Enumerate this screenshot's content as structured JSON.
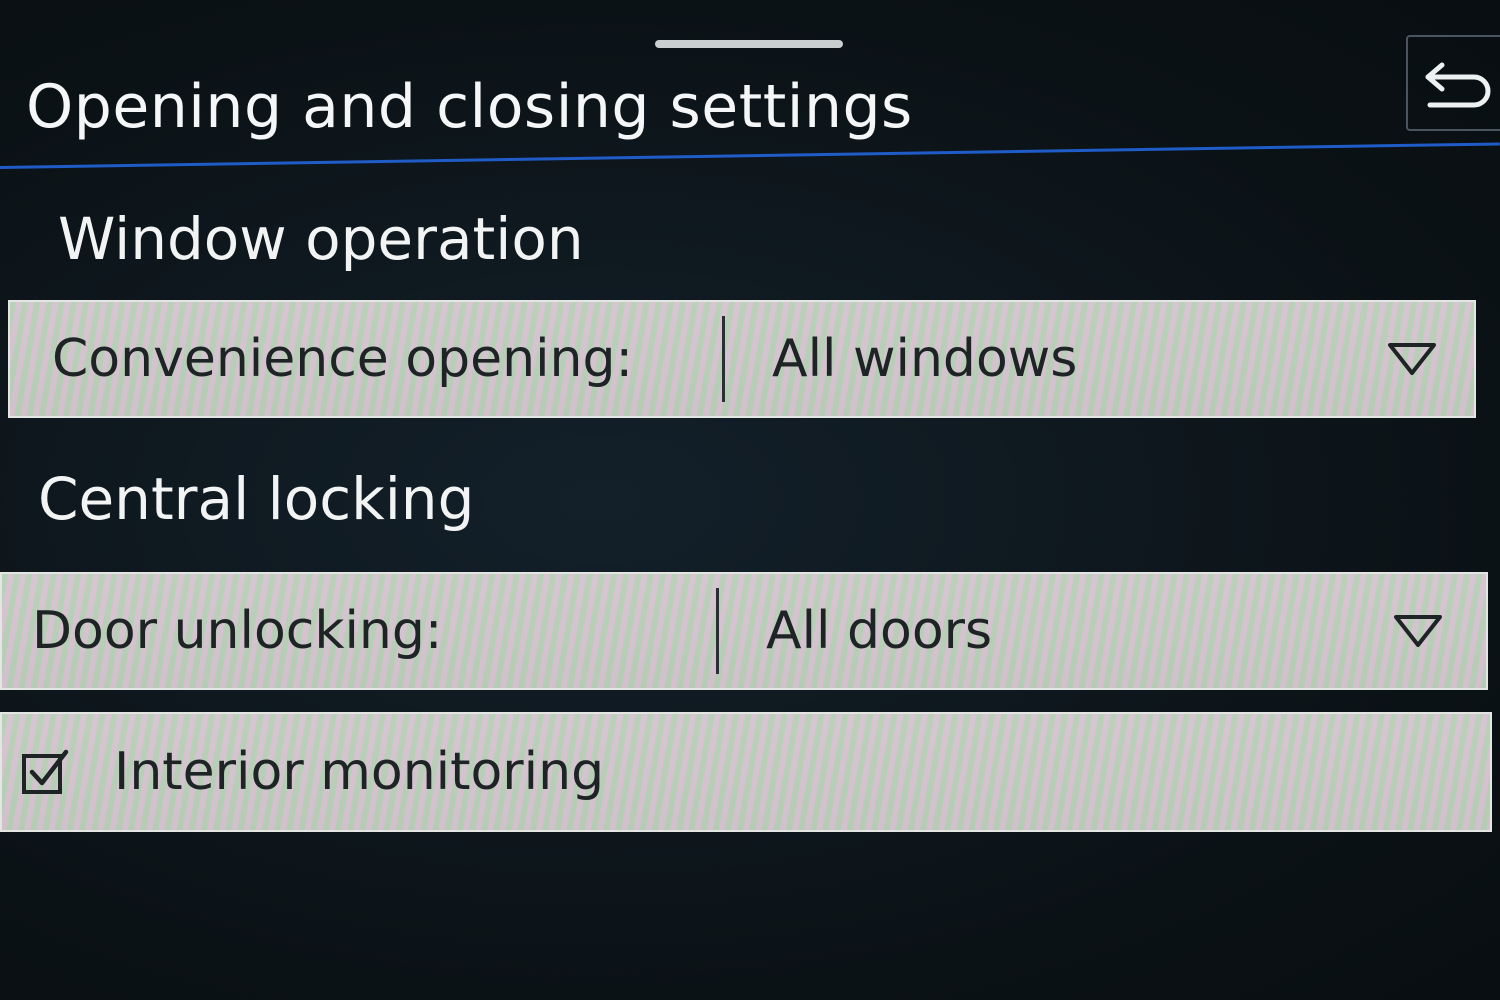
{
  "header": {
    "title": "Opening and closing settings",
    "back_icon": "back-arrow-icon",
    "accent_color": "#1f5cc8"
  },
  "sections": {
    "window_operation": {
      "title": "Window operation",
      "convenience_opening": {
        "label": "Convenience opening:",
        "value": "All windows",
        "dropdown_icon": "chevron-down-icon"
      }
    },
    "central_locking": {
      "title": "Central locking",
      "door_unlocking": {
        "label": "Door unlocking:",
        "value": "All doors",
        "dropdown_icon": "chevron-down-icon"
      },
      "interior_monitoring": {
        "label": "Interior monitoring",
        "checked": true,
        "checkbox_icon": "checkbox-checked-icon"
      }
    }
  }
}
